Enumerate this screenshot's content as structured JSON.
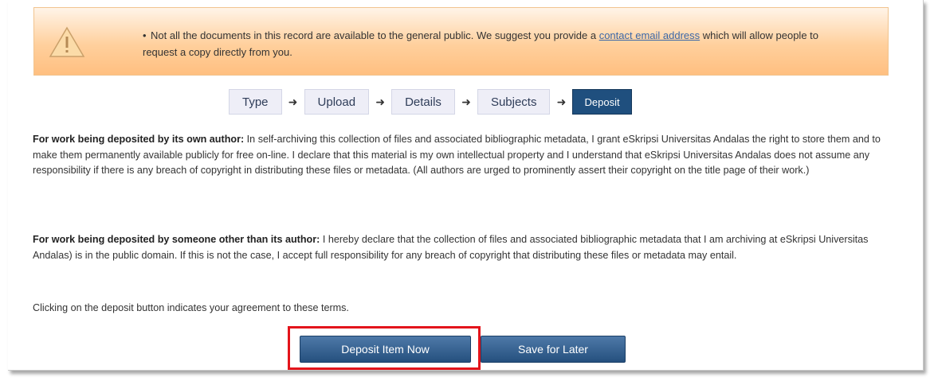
{
  "warning": {
    "text_part1": "Not all the documents in this record are available to the general public. We suggest you provide a ",
    "link_text": "contact email address",
    "text_part2": " which will allow people to request a copy directly from you."
  },
  "steps": [
    "Type",
    "Upload",
    "Details",
    "Subjects",
    "Deposit"
  ],
  "active_step": "Deposit",
  "terms": {
    "p1_bold": "For work being deposited by its own author:",
    "p1_text": " In self-archiving this collection of files and associated bibliographic metadata, I grant eSkripsi Universitas Andalas the right to store them and to make them permanently available publicly for free on-line. I declare that this material is my own intellectual property and I understand that eSkripsi Universitas Andalas does not assume any responsibility if there is any breach of copyright in distributing these files or metadata. (All authors are urged to prominently assert their copyright on the title page of their work.)",
    "p2_bold": "For work being deposited by someone other than its author:",
    "p2_text": " I hereby declare that the collection of files and associated bibliographic metadata that I am archiving at eSkripsi Universitas Andalas) is in the public domain. If this is not the case, I accept full responsibility for any breach of copyright that distributing these files or metadata may entail.",
    "p3_text": "Clicking on the deposit button indicates your agreement to these terms."
  },
  "buttons": {
    "deposit": "Deposit Item Now",
    "save": "Save for Later"
  },
  "colors": {
    "highlight": "#e3141b",
    "active_step": "#1f4f7e",
    "button": "#2d5a8a",
    "warning_bg": "#ffcf9b"
  }
}
